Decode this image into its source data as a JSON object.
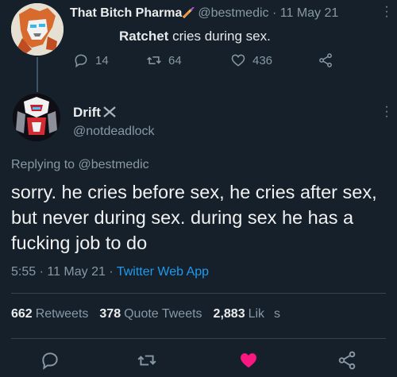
{
  "parent_tweet": {
    "display_name": "That Bitch Pharma",
    "handle": "@bestmedic",
    "separator": "·",
    "date": "11 May 21",
    "text_mention": "Ratchet",
    "text_rest": " cries during sex.",
    "replies": "14",
    "retweets": "64",
    "likes": "436"
  },
  "main_tweet": {
    "display_name": "Drift",
    "handle": "@notdeadlock",
    "replying_prefix": "Replying to ",
    "replying_handle": "@bestmedic",
    "text": "sorry. he cries before sex, he cries after sex, but never during sex. during sex he has a fucking job to do",
    "time": "5:55",
    "date": "11 May 21",
    "sep1": "·",
    "sep2": "·",
    "source_app": "Twitter Web App",
    "retweets_count": "662",
    "retweets_label": "Retweets",
    "quote_count": "378",
    "quote_label": "Quote Tweets",
    "likes_count": "2,883",
    "likes_label": "Lik",
    "likes_label_tail": "s"
  },
  "icons": {
    "reply": "reply-icon",
    "retweet": "retweet-icon",
    "like": "heart-icon",
    "share": "share-icon",
    "more": "more-icon",
    "name_emoji": "syringe-emoji-icon",
    "name_cross": "crossed-swords-icon"
  },
  "colors": {
    "background": "#15202b",
    "link": "#1d9bf0",
    "muted": "#8899a6",
    "liked": "#f91880"
  }
}
